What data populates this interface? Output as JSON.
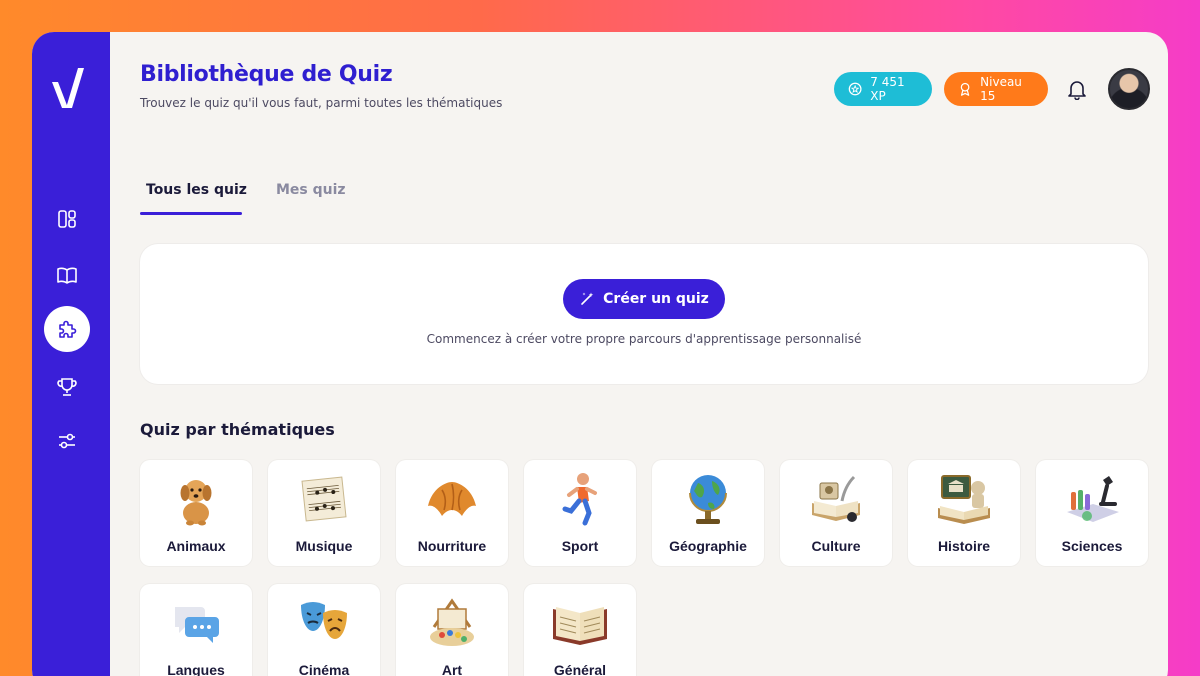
{
  "header": {
    "title": "Bibliothèque de Quiz",
    "subtitle": "Trouvez le quiz qu'il vous faut, parmi toutes les thématiques",
    "xp_label": "7 451 XP",
    "level_label": "Niveau 15"
  },
  "tabs": [
    {
      "label": "Tous les quiz"
    },
    {
      "label": "Mes quiz"
    }
  ],
  "create": {
    "button_label": "Créer un quiz",
    "description": "Commencez à créer votre propre parcours d'apprentissage personnalisé"
  },
  "section": {
    "title": "Quiz par thématiques"
  },
  "categories": [
    {
      "label": "Animaux",
      "icon": "dog-icon"
    },
    {
      "label": "Musique",
      "icon": "sheet-music-icon"
    },
    {
      "label": "Nourriture",
      "icon": "croissant-icon"
    },
    {
      "label": "Sport",
      "icon": "runner-icon"
    },
    {
      "label": "Géographie",
      "icon": "globe-icon"
    },
    {
      "label": "Culture",
      "icon": "book-quill-icon"
    },
    {
      "label": "Histoire",
      "icon": "museum-icon"
    },
    {
      "label": "Sciences",
      "icon": "microscope-icon"
    },
    {
      "label": "Langues",
      "icon": "speech-bubbles-icon"
    },
    {
      "label": "Cinéma",
      "icon": "theater-masks-icon"
    },
    {
      "label": "Art",
      "icon": "palette-icon"
    },
    {
      "label": "Général",
      "icon": "open-book-icon"
    }
  ],
  "colors": {
    "brand": "#3a1fd8",
    "xp": "#1ebdd6",
    "level": "#ff7a1a"
  }
}
